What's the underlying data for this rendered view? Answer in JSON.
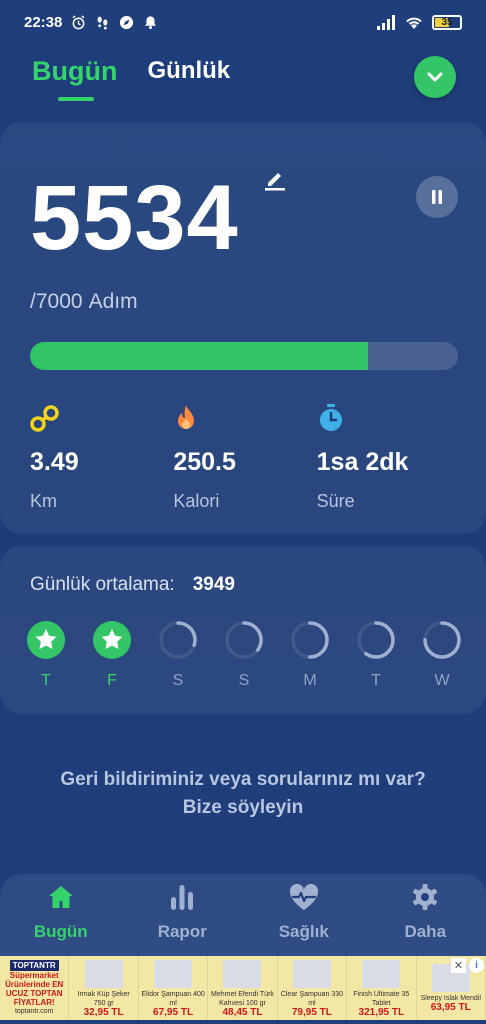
{
  "status_bar": {
    "time": "22:38",
    "battery": "35",
    "icons": [
      "alarm-icon",
      "footsteps-icon",
      "compass-icon",
      "bell-icon",
      "signal-icon",
      "wifi-icon",
      "battery-icon"
    ]
  },
  "header": {
    "tabs": [
      {
        "label": "Bugün",
        "active": true
      },
      {
        "label": "Günlük",
        "active": false
      }
    ],
    "action_icon": "check-icon"
  },
  "steps": {
    "count": "5534",
    "goal": "/7000",
    "unit": "Adım",
    "progress": 0.79
  },
  "stats": [
    {
      "icon": "distance-icon",
      "value": "3.49",
      "label": "Km",
      "color": "#f2d21b"
    },
    {
      "icon": "flame-icon",
      "value": "250.5",
      "label": "Kalori",
      "color": "#ff8a3d"
    },
    {
      "icon": "clock-icon",
      "value": "1sa 2dk",
      "label": "Süre",
      "color": "#3fb0ea"
    }
  ],
  "daily_average": {
    "label": "Günlük ortalama:",
    "value": "3949"
  },
  "days": [
    {
      "label": "T",
      "done": true,
      "progress": 1.0
    },
    {
      "label": "F",
      "done": true,
      "progress": 1.0
    },
    {
      "label": "S",
      "done": false,
      "progress": 0.3
    },
    {
      "label": "S",
      "done": false,
      "progress": 0.35
    },
    {
      "label": "M",
      "done": false,
      "progress": 0.5
    },
    {
      "label": "T",
      "done": false,
      "progress": 0.6
    },
    {
      "label": "W",
      "done": false,
      "progress": 0.75
    }
  ],
  "feedback": {
    "line1": "Geri bildiriminiz veya sorularınız mı var?",
    "line2": "Bize söyleyin"
  },
  "bottom_nav": [
    {
      "label": "Bugün",
      "icon": "home-icon",
      "active": true
    },
    {
      "label": "Rapor",
      "icon": "bar-chart-icon",
      "active": false
    },
    {
      "label": "Sağlık",
      "icon": "heart-pulse-icon",
      "active": false
    },
    {
      "label": "Daha",
      "icon": "gear-icon",
      "active": false
    }
  ],
  "ad": {
    "brand": "TOPTANTR",
    "slogan": "Süpermarket Ürünlerinde EN UCUZ TOPTAN FİYATLAR!",
    "site": "toptantr.com",
    "products": [
      {
        "name": "Irmak Küp Şeker 750 gr",
        "price": "32,95 TL"
      },
      {
        "name": "Elidor Şampuan 400 ml",
        "price": "67,95 TL"
      },
      {
        "name": "Mehmet Efendi Türk Kahvesi 100 gr",
        "price": "48,45 TL"
      },
      {
        "name": "Clear Şampuan 330 ml",
        "price": "79,95 TL"
      },
      {
        "name": "Finish Ultimate 35 Tablet",
        "price": "321,95 TL"
      },
      {
        "name": "Sleepy Islak Mendil",
        "price": "63,95 TL"
      }
    ]
  },
  "colors": {
    "accent": "#35d36b",
    "background": "#1e3f7c",
    "progress_track": "#3a5690"
  }
}
